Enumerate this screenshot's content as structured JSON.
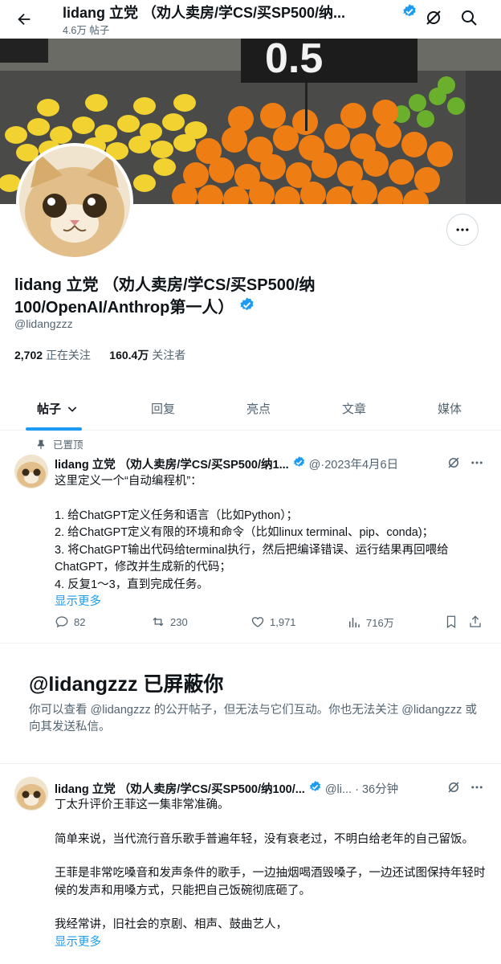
{
  "header": {
    "title": "lidang 立党 （劝人卖房/学CS/买SP500/纳...",
    "subtitle": "4.6万 帖子"
  },
  "profile": {
    "name_line1": "lidang 立党 （劝人卖房/学CS/买SP500/纳",
    "name_line2": "100/OpenAI/Anthrop第一人）",
    "handle": "@lidangzzz",
    "following_count": "2,702",
    "following_label": "正在关注",
    "followers_count": "160.4万",
    "followers_label": "关注者"
  },
  "tabs": [
    {
      "label": "帖子"
    },
    {
      "label": "回复"
    },
    {
      "label": "亮点"
    },
    {
      "label": "文章"
    },
    {
      "label": "媒体"
    }
  ],
  "pinned_tweet": {
    "pinned_label": "已置顶",
    "author": "lidang 立党 （劝人卖房/学CS/买SP500/纳1...",
    "meta": "@·2023年4月6日",
    "line1": "这里定义一个“自动编程机”：",
    "line2": "1. 给ChatGPT定义任务和语言（比如Python）；",
    "line3": "2. 给ChatGPT定义有限的环境和命令（比如linux terminal、pip、conda)；",
    "line4": "3. 将ChatGPT输出代码给terminal执行，然后把编译错误、运行结果再回喂给ChatGPT，修改并生成新的代码；",
    "line5": "4. 反复1～3，直到完成任务。",
    "show_more": "显示更多",
    "replies": "82",
    "retweets": "230",
    "likes": "1,971",
    "views": "716万"
  },
  "blocked": {
    "title": "@lidangzzz 已屏蔽你",
    "text": "你可以查看 @lidangzzz 的公开帖子，但无法与它们互动。你也无法关注 @lidangzzz 或向其发送私信。"
  },
  "second_tweet": {
    "author": "lidang 立党 （劝人卖房/学CS/买SP500/纳100/...",
    "meta": "@li... · 36分钟",
    "line1": "丁太升评价王菲这一集非常准确。",
    "line2": "简单来说，当代流行音乐歌手普遍年轻，没有衰老过，不明白给老年的自己留饭。",
    "line3": "王菲是非常吃嗓音和发声条件的歌手，一边抽烟喝酒毁嗓子，一边还试图保持年轻时候的发声和用嗓方式，只能把自己饭碗彻底砸了。",
    "line4": "我经常讲，旧社会的京剧、相声、鼓曲艺人，",
    "show_more": "显示更多"
  },
  "colors": {
    "accent": "#1d9bf0",
    "secondary_text": "#536471",
    "verified": "#1d9bf0"
  }
}
